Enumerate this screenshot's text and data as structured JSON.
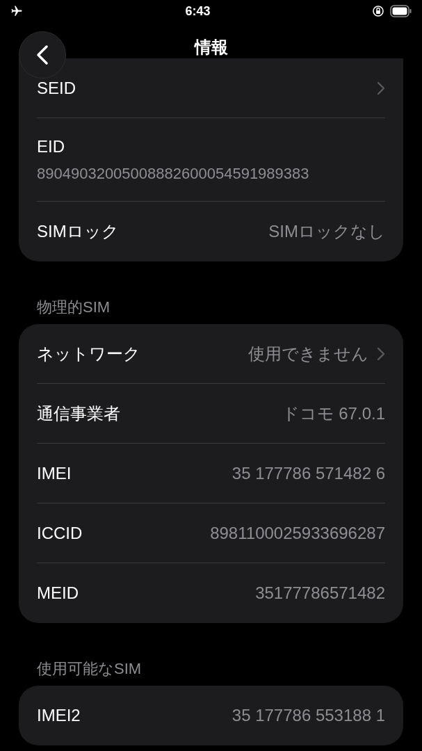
{
  "status_bar": {
    "time": "6:43"
  },
  "header": {
    "title": "情報"
  },
  "sections": [
    {
      "rows": [
        {
          "kind": "inline",
          "label": "SEID",
          "chevron": true
        },
        {
          "kind": "stacked",
          "label": "EID",
          "value": "89049032005008882600054591989383",
          "chevron": false
        },
        {
          "kind": "inline",
          "label": "SIMロック",
          "value": "SIMロックなし",
          "chevron": false
        }
      ]
    },
    {
      "title": "物理的SIM",
      "rows": [
        {
          "kind": "inline",
          "label": "ネットワーク",
          "value": "使用できません",
          "chevron": true
        },
        {
          "kind": "inline",
          "label": "通信事業者",
          "value": "ドコモ 67.0.1",
          "chevron": false
        },
        {
          "kind": "inline",
          "label": "IMEI",
          "value": "35 177786 571482 6",
          "chevron": false
        },
        {
          "kind": "inline",
          "label": "ICCID",
          "value": "8981100025933696287",
          "chevron": false
        },
        {
          "kind": "inline",
          "label": "MEID",
          "value": "35177786571482",
          "chevron": false
        }
      ]
    },
    {
      "title": "使用可能なSIM",
      "rows": [
        {
          "kind": "inline",
          "label": "IMEI2",
          "value": "35 177786 553188 1",
          "chevron": false
        }
      ]
    }
  ]
}
